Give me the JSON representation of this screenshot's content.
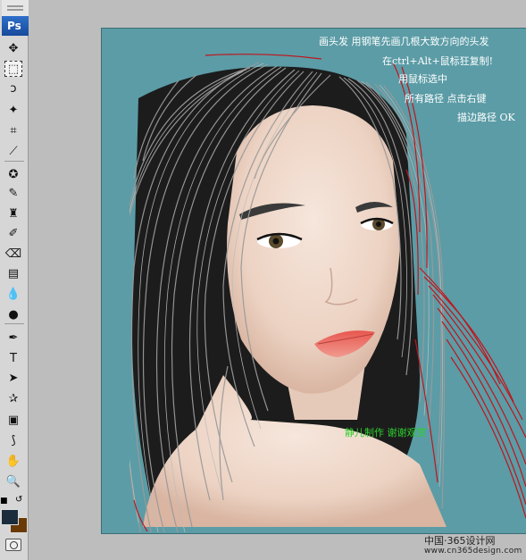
{
  "app": {
    "logo_text": "Ps"
  },
  "toolbar": {
    "tools": [
      {
        "name": "move-tool-icon",
        "glyph": "✥"
      },
      {
        "name": "marquee-tool-icon",
        "glyph": "⬚",
        "active": true
      },
      {
        "name": "lasso-tool-icon",
        "glyph": "ↄ"
      },
      {
        "name": "magic-wand-tool-icon",
        "glyph": "✦"
      },
      {
        "name": "crop-tool-icon",
        "glyph": "⌗"
      },
      {
        "name": "slice-tool-icon",
        "glyph": "⟋"
      },
      {
        "name": "healing-brush-tool-icon",
        "glyph": "✪"
      },
      {
        "name": "brush-tool-icon",
        "glyph": "✎"
      },
      {
        "name": "clone-stamp-tool-icon",
        "glyph": "♜"
      },
      {
        "name": "history-brush-tool-icon",
        "glyph": "✐"
      },
      {
        "name": "eraser-tool-icon",
        "glyph": "⌫"
      },
      {
        "name": "gradient-tool-icon",
        "glyph": "▤"
      },
      {
        "name": "blur-tool-icon",
        "glyph": "💧"
      },
      {
        "name": "dodge-tool-icon",
        "glyph": "●"
      },
      {
        "name": "pen-tool-icon",
        "glyph": "✒"
      },
      {
        "name": "type-tool-icon",
        "glyph": "T"
      },
      {
        "name": "path-selection-tool-icon",
        "glyph": "➤"
      },
      {
        "name": "shape-tool-icon",
        "glyph": "✰"
      },
      {
        "name": "notes-tool-icon",
        "glyph": "▣"
      },
      {
        "name": "eyedropper-tool-icon",
        "glyph": "⟆"
      },
      {
        "name": "hand-tool-icon",
        "glyph": "✋"
      },
      {
        "name": "zoom-tool-icon",
        "glyph": "🔍"
      }
    ],
    "foreground_color": "#1b2d3c",
    "background_color": "#6a3a06"
  },
  "document": {
    "background_color": "#5b9ca6",
    "notes": [
      "画头发 用钢笔先画几根大致方向的头发",
      "在ctrl+Alt+鼠标狂复制!",
      "用鼠标选中",
      "所有路径 点击右键",
      "描边路径 OK"
    ],
    "credit": "静儿制作 谢谢观赏"
  },
  "watermark": {
    "line1": "中国·365设计网",
    "line2": "www.cn365design.com"
  }
}
